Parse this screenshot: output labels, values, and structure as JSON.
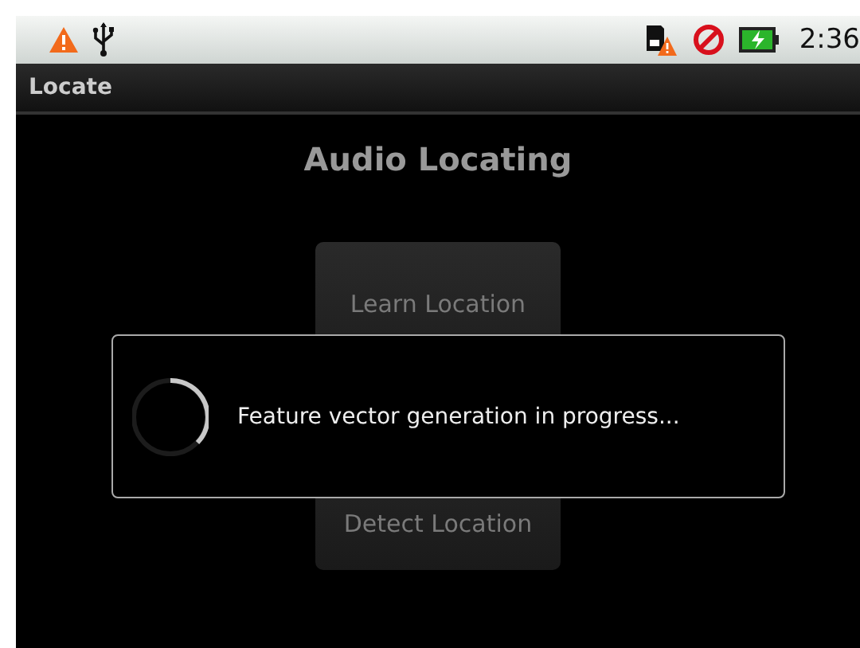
{
  "status_bar": {
    "time": "2:36"
  },
  "title_bar": {
    "title": "Locate"
  },
  "heading": "Audio Locating",
  "buttons": [
    {
      "label": "Learn Location"
    },
    {
      "label": "Detect Location"
    }
  ],
  "dialog": {
    "message": "Feature vector generation in progress..."
  }
}
